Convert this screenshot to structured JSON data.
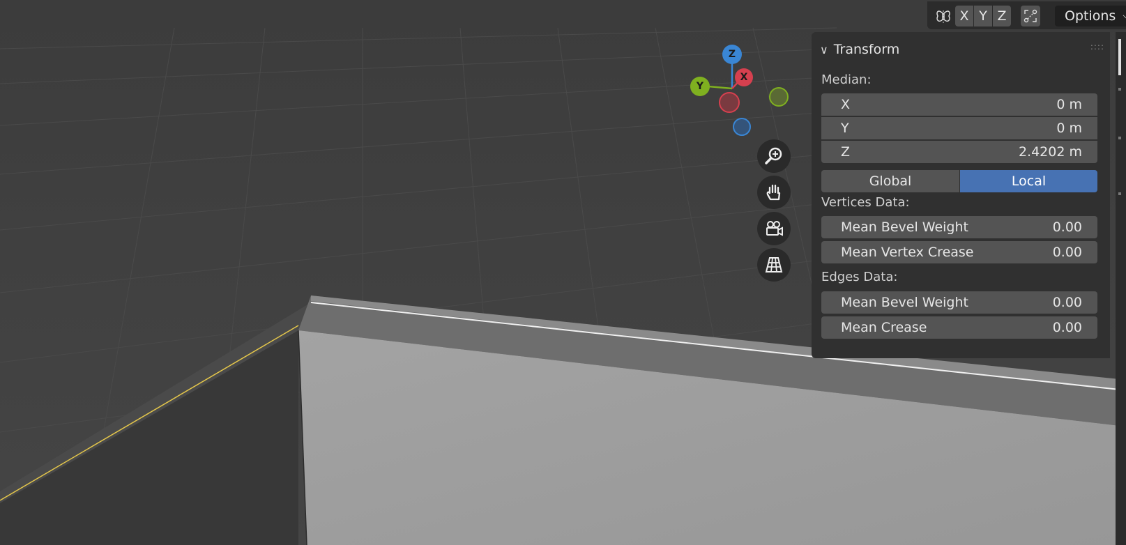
{
  "header": {
    "axis_x": "X",
    "axis_y": "Y",
    "axis_z": "Z",
    "options_label": "Options"
  },
  "gizmo": {
    "z_label": "Z",
    "y_label": "Y",
    "x_label": "X",
    "colors": {
      "x": "#d6404f",
      "y": "#7fb020",
      "z": "#3a86d4"
    }
  },
  "nav": {
    "zoom_icon": "zoom-icon",
    "pan_icon": "hand-pan-icon",
    "camera_icon": "camera-icon",
    "grid_icon": "ortho-grid-icon"
  },
  "panel": {
    "title": "Transform",
    "median_label": "Median:",
    "x": {
      "label": "X",
      "value": "0 m"
    },
    "y": {
      "label": "Y",
      "value": "0 m"
    },
    "z": {
      "label": "Z",
      "value": "2.4202 m"
    },
    "global_label": "Global",
    "local_label": "Local",
    "vertices_label": "Vertices Data:",
    "vert_bevel": {
      "label": "Mean Bevel Weight",
      "value": "0.00"
    },
    "vert_crease": {
      "label": "Mean Vertex Crease",
      "value": "0.00"
    },
    "edges_label": "Edges Data:",
    "edge_bevel": {
      "label": "Mean Bevel Weight",
      "value": "0.00"
    },
    "edge_crease": {
      "label": "Mean Crease",
      "value": "0.00"
    }
  }
}
